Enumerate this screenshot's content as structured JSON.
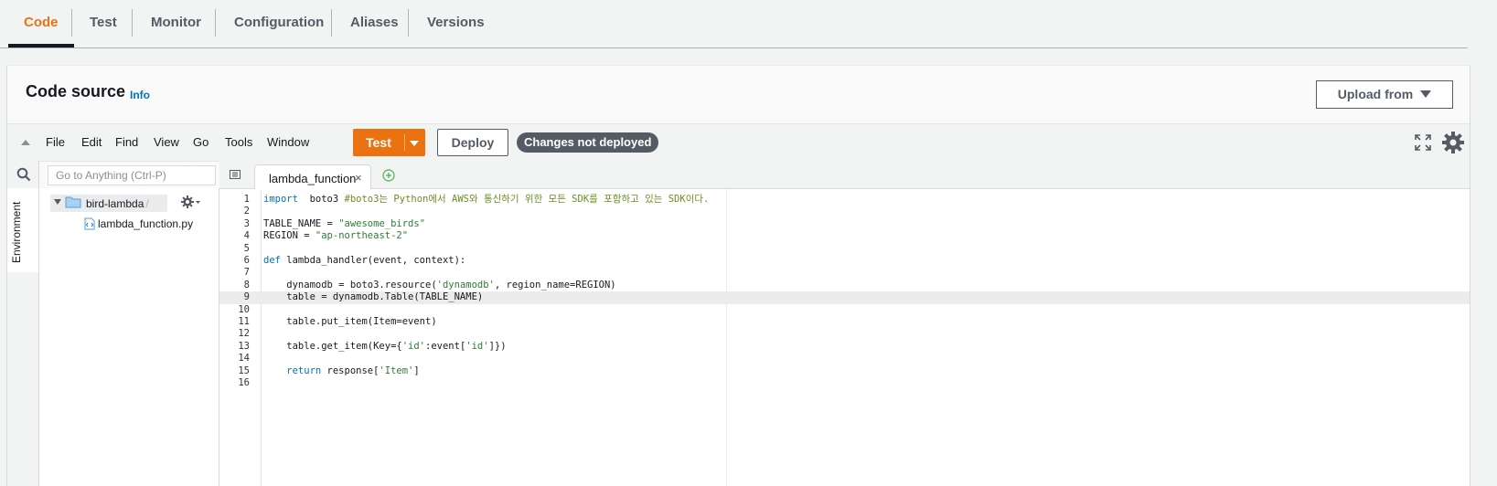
{
  "tabs": [
    "Code",
    "Test",
    "Monitor",
    "Configuration",
    "Aliases",
    "Versions"
  ],
  "active_tab": "Code",
  "panel": {
    "title": "Code source",
    "info": "Info",
    "upload_label": "Upload from"
  },
  "toolbar": {
    "menu": [
      "File",
      "Edit",
      "Find",
      "View",
      "Go",
      "Tools",
      "Window"
    ],
    "test_label": "Test",
    "deploy_label": "Deploy",
    "status_badge": "Changes not deployed"
  },
  "sidebar": {
    "search_placeholder": "Go to Anything (Ctrl-P)",
    "environment_label": "Environment",
    "root_folder": "bird-lambda",
    "root_path": "- /",
    "file": "lambda_function.py"
  },
  "editor": {
    "tab_name": "lambda_function",
    "active_line": 9,
    "lines": [
      {
        "n": "1",
        "segs": [
          [
            "kw",
            "import"
          ],
          [
            "",
            "  boto3 "
          ],
          [
            "cmt",
            "#boto3는 Python에서 AWS와 통신하기 위한 모든 SDK를 포함하고 있는 SDK이다."
          ]
        ]
      },
      {
        "n": "2",
        "segs": []
      },
      {
        "n": "3",
        "segs": [
          [
            "",
            "TABLE_NAME = "
          ],
          [
            "str",
            "\"awesome_birds\""
          ]
        ]
      },
      {
        "n": "4",
        "segs": [
          [
            "",
            "REGION = "
          ],
          [
            "str",
            "\"ap-northeast-2\""
          ]
        ]
      },
      {
        "n": "5",
        "segs": []
      },
      {
        "n": "6",
        "segs": [
          [
            "kw",
            "def"
          ],
          [
            "",
            " lambda_handler(event, context):"
          ]
        ]
      },
      {
        "n": "7",
        "segs": []
      },
      {
        "n": "8",
        "segs": [
          [
            "",
            "    dynamodb = boto3.resource("
          ],
          [
            "str",
            "'dynamodb'"
          ],
          [
            "",
            ", region_name=REGION)"
          ]
        ]
      },
      {
        "n": "9",
        "segs": [
          [
            "",
            "    table = dynamodb.Table(TABLE_NAME)"
          ]
        ]
      },
      {
        "n": "10",
        "segs": []
      },
      {
        "n": "11",
        "segs": [
          [
            "",
            "    table.put_item(Item=event)"
          ]
        ]
      },
      {
        "n": "12",
        "segs": []
      },
      {
        "n": "13",
        "segs": [
          [
            "",
            "    table.get_item(Key={"
          ],
          [
            "str",
            "'id'"
          ],
          [
            "",
            ":event["
          ],
          [
            "str",
            "'id'"
          ],
          [
            "",
            "]})"
          ]
        ]
      },
      {
        "n": "14",
        "segs": []
      },
      {
        "n": "15",
        "segs": [
          [
            "kw",
            "    return"
          ],
          [
            "",
            " response["
          ],
          [
            "str",
            "'Item'"
          ],
          [
            "",
            "]"
          ]
        ]
      },
      {
        "n": "16",
        "segs": []
      }
    ]
  },
  "colors": {
    "accent": "#ec7211",
    "link": "#0073bb",
    "badge_bg": "#545b64"
  }
}
